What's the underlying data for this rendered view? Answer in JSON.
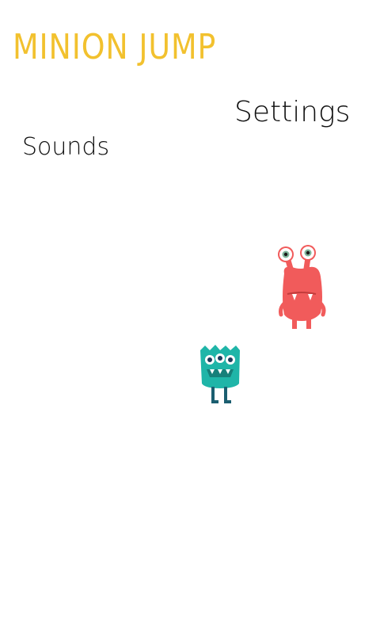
{
  "game": {
    "title": "MINION JUMP"
  },
  "menu": {
    "settings_label": "Settings",
    "sounds_label": "Sounds"
  },
  "characters": {
    "red_monster": {
      "icon": "red-monster-icon",
      "color": "#f15b5b"
    },
    "teal_monster": {
      "icon": "teal-monster-icon",
      "color": "#1fb5a8"
    }
  },
  "colors": {
    "title": "#f2c12e",
    "text": "#111111",
    "background": "#ffffff"
  }
}
